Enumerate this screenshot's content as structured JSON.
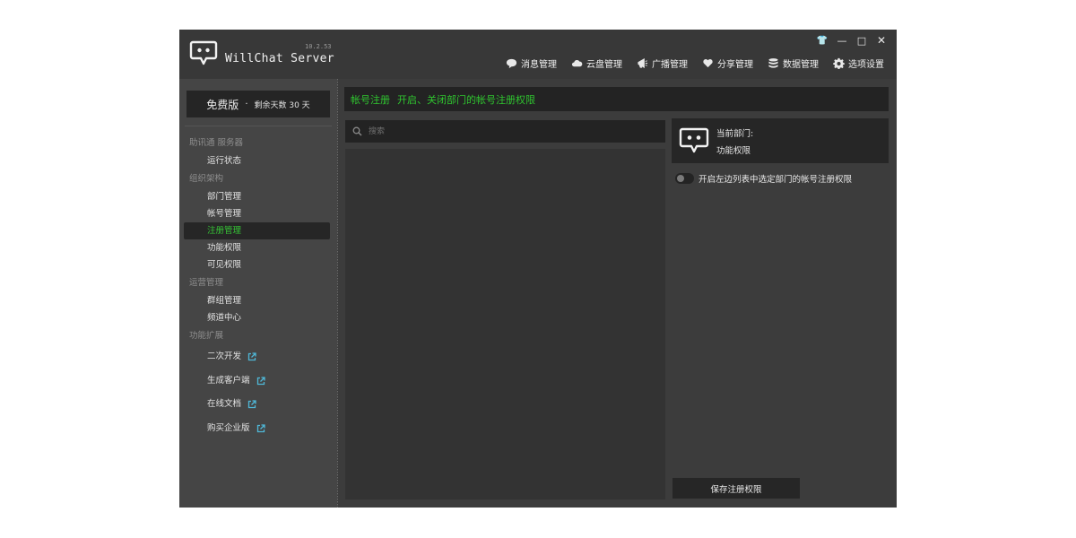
{
  "app": {
    "title": "WillChat Server",
    "version": "10.2.53"
  },
  "window_controls": {
    "skin": "👕",
    "minimize": "—",
    "maximize": "□",
    "close": "✕"
  },
  "topnav": [
    {
      "label": "消息管理",
      "icon": "chat-bubble-icon"
    },
    {
      "label": "云盘管理",
      "icon": "cloud-icon"
    },
    {
      "label": "广播管理",
      "icon": "megaphone-icon"
    },
    {
      "label": "分享管理",
      "icon": "heart-icon"
    },
    {
      "label": "数据管理",
      "icon": "database-icon"
    },
    {
      "label": "选项设置",
      "icon": "gear-icon"
    }
  ],
  "license": {
    "edition": "免费版",
    "dot": "·",
    "days_text": "剩余天数 30 天"
  },
  "sidebar": {
    "groups": [
      {
        "label": "助讯通 服务器",
        "items": [
          "运行状态"
        ]
      },
      {
        "label": "组织架构",
        "items": [
          "部门管理",
          "帐号管理",
          "注册管理",
          "功能权限",
          "可见权限"
        ]
      },
      {
        "label": "运营管理",
        "items": [
          "群组管理",
          "频道中心"
        ]
      },
      {
        "label": "功能扩展",
        "external": [
          "二次开发",
          "生成客户端",
          "在线文档",
          "购买企业版"
        ]
      }
    ],
    "active_item": "注册管理"
  },
  "header": {
    "section": "帐号注册",
    "description": "开启、关闭部门的帐号注册权限"
  },
  "search": {
    "placeholder": "搜索",
    "value": ""
  },
  "department": {
    "label": "当前部门:",
    "name": "功能权限"
  },
  "toggle": {
    "label": "开启左边列表中选定部门的帐号注册权限",
    "on": false
  },
  "save_button": {
    "label": "保存注册权限"
  },
  "colors": {
    "accent_green": "#35c435",
    "background": "#3c3c3c",
    "panel_dark": "#232323"
  }
}
